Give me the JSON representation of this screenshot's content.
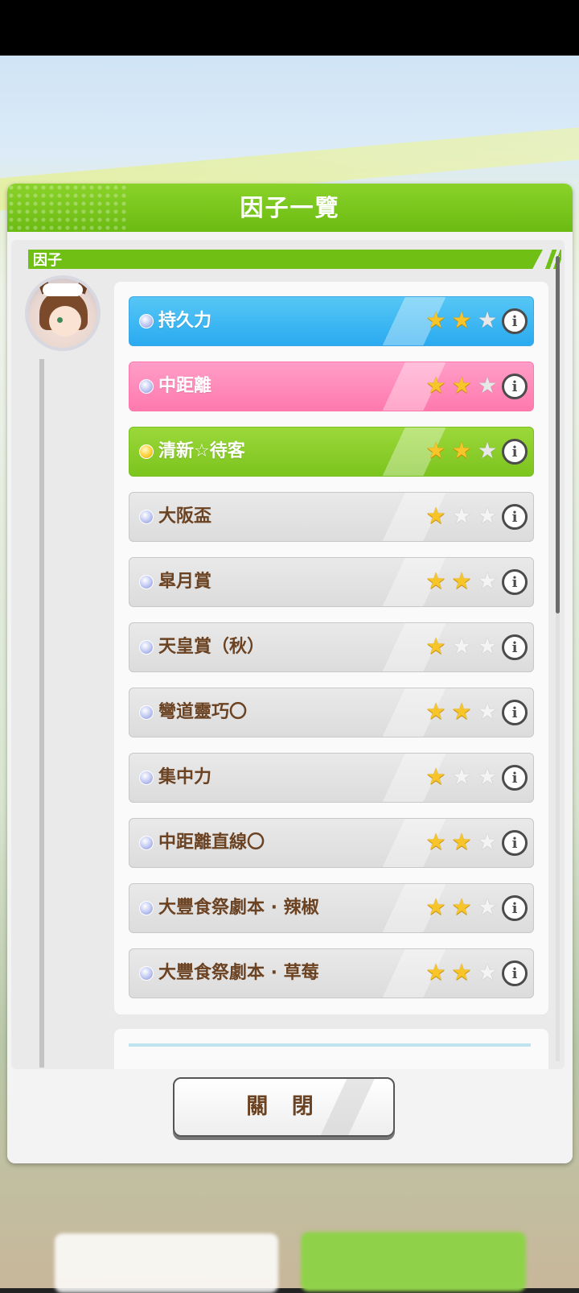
{
  "dialog": {
    "title": "因子一覽",
    "section_label": "因子",
    "close_label": "關 閉"
  },
  "factors": [
    {
      "label": "持久力",
      "stars": 2,
      "max_stars": 3,
      "color": "blue",
      "dot": "silver"
    },
    {
      "label": "中距離",
      "stars": 2,
      "max_stars": 3,
      "color": "pink",
      "dot": "silver"
    },
    {
      "label": "清新☆待客",
      "stars": 2,
      "max_stars": 3,
      "color": "green",
      "dot": "gold"
    },
    {
      "label": "大阪盃",
      "stars": 1,
      "max_stars": 3,
      "color": "gray",
      "dot": "silver"
    },
    {
      "label": "皐月賞",
      "stars": 2,
      "max_stars": 3,
      "color": "gray",
      "dot": "silver"
    },
    {
      "label": "天皇賞（秋）",
      "stars": 1,
      "max_stars": 3,
      "color": "gray",
      "dot": "silver"
    },
    {
      "label": "彎道靈巧〇",
      "stars": 2,
      "max_stars": 3,
      "color": "gray",
      "dot": "silver"
    },
    {
      "label": "集中力",
      "stars": 1,
      "max_stars": 3,
      "color": "gray",
      "dot": "silver"
    },
    {
      "label": "中距離直線〇",
      "stars": 2,
      "max_stars": 3,
      "color": "gray",
      "dot": "silver"
    },
    {
      "label": "大豐食祭劇本 · 辣椒",
      "stars": 2,
      "max_stars": 3,
      "color": "gray",
      "dot": "silver"
    },
    {
      "label": "大豐食祭劇本 · 草莓",
      "stars": 2,
      "max_stars": 3,
      "color": "gray",
      "dot": "silver"
    }
  ],
  "colors": {
    "header_green": "#7cc41e",
    "blue": "#2aaaf0",
    "pink": "#ff79ad",
    "green": "#7cc41e",
    "gray": "#dcdcdc",
    "text_brown": "#6b4222"
  },
  "icons": {
    "info": "info-icon",
    "star": "star-icon",
    "info_glyph": "i",
    "star_glyph": "★"
  }
}
